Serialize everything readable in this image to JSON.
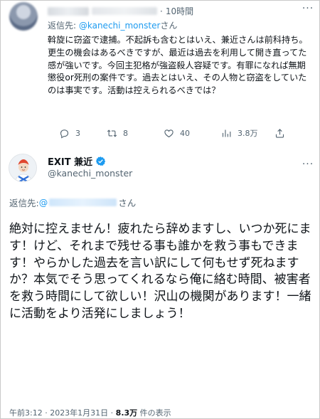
{
  "reply_tweet": {
    "time": "10時間",
    "reply_to_prefix": "返信先: ",
    "reply_to_handle": "@kanechi_monster",
    "reply_to_suffix": "さん",
    "body": "斡旋に窃盗で逮捕。不起訴も含むとはいえ、兼近さんは前科持ち。更生の機会はあるべきですが、最近は過去を利用して開き直ってた感が強いです。今回主犯格が強盗殺人容疑です。有罪になれば無期懲役or死刑の案件です。過去とはいえ、その人物と窃盗をしていたのは事実です。活動は控えられるべきでは？",
    "actions": {
      "replies": "3",
      "retweets": "8",
      "likes": "40",
      "views": "3.8万"
    }
  },
  "main_tweet": {
    "display_name": "EXIT 兼近",
    "handle": "@kanechi_monster",
    "reply_to_prefix": "返信先: ",
    "reply_to_at": "@",
    "reply_to_suffix": "さん",
    "body": "絶対に控えません！疲れたら辞めますし、いつか死にます！けど、それまで残せる事も誰かを救う事もできます！やらかした過去を言い訳にして何もせず死ねますか？本気でそう思ってくれるなら俺に絡む時間、被害者を救う時間にして欲しい！沢山の機関があります！一緒に活動をより活発にしましょう！",
    "timestamp": "午前3:12 · 2023年1月31日 · ",
    "views_count": "8.3万",
    "views_label": " 件の表示"
  },
  "colors": {
    "accent": "#1d9bf0",
    "secondary_text": "#536471",
    "primary_text": "#0f1419"
  }
}
